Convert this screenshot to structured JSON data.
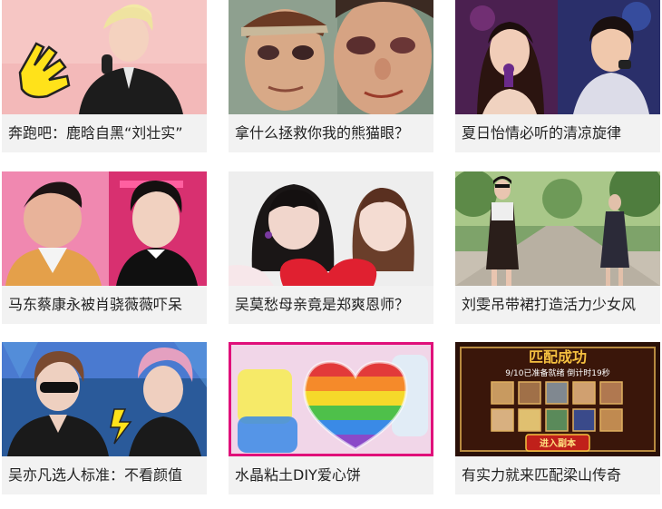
{
  "cards": [
    {
      "caption": "奔跑吧：鹿晗自黑“刘壮实”",
      "thumb": "running-man-luhan-thumbnail"
    },
    {
      "caption": "拿什么拯救你我的熊猫眼？",
      "thumb": "panda-eyes-thumbnail"
    },
    {
      "caption": "夏日怡情必听的清凉旋律",
      "thumb": "summer-singers-thumbnail"
    },
    {
      "caption": "马东蔡康永被肖骁薇薇吓呆",
      "thumb": "variety-show-hosts-thumbnail"
    },
    {
      "caption": "吴莫愁母亲竟是郑爽恩师？",
      "thumb": "two-women-portrait-thumbnail"
    },
    {
      "caption": "刘雯吊带裙打造活力少女风",
      "thumb": "street-style-thumbnail"
    },
    {
      "caption": "吴亦凡选人标准：不看颜值",
      "thumb": "kris-wu-show-thumbnail"
    },
    {
      "caption": "水晶粘土DIY爱心饼",
      "thumb": "rainbow-heart-slime-thumbnail"
    },
    {
      "caption": "有实力就来匹配梁山传奇",
      "thumb": "game-match-thumbnail"
    }
  ],
  "game_overlay": {
    "title": "匹配成功",
    "subtitle": "9/10已准备就绪 倒计时19秒",
    "button": "进入副本"
  },
  "colors": {
    "caption_bg": "#f2f2f2",
    "caption_text": "#222222",
    "slime_border": "#e0107a"
  }
}
